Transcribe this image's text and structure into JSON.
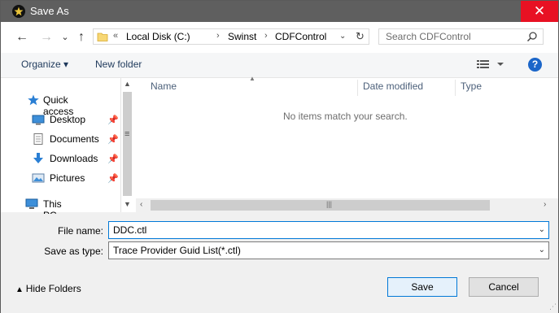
{
  "window": {
    "title": "Save As",
    "close_glyph": "✕"
  },
  "nav": {
    "back_glyph": "←",
    "forward_glyph": "→",
    "recent_glyph": "⌄",
    "up_glyph": "↑",
    "breadcrumb": {
      "overflow": "«",
      "segments": [
        "Local Disk (C:)",
        "Swinst",
        "CDFControl"
      ],
      "separator": "›"
    },
    "search_placeholder": "Search CDFControl"
  },
  "toolbar": {
    "organize": "Organize ▾",
    "new_folder": "New folder",
    "help": "?"
  },
  "navpane": {
    "items": [
      {
        "label": "Quick access",
        "icon": "star-icon"
      },
      {
        "label": "Desktop",
        "icon": "desktop-icon",
        "pinned": true
      },
      {
        "label": "Documents",
        "icon": "documents-icon",
        "pinned": true
      },
      {
        "label": "Downloads",
        "icon": "downloads-icon",
        "pinned": true
      },
      {
        "label": "Pictures",
        "icon": "pictures-icon",
        "pinned": true
      },
      {
        "label": "This PC",
        "icon": "computer-icon"
      }
    ]
  },
  "filelist": {
    "columns": [
      "Name",
      "Date modified",
      "Type"
    ],
    "empty_message": "No items match your search."
  },
  "form": {
    "file_name_label": "File name:",
    "file_name_value": "DDC.ctl",
    "save_type_label": "Save as type:",
    "save_type_value": "Trace Provider Guid List(*.ctl)"
  },
  "footer": {
    "hide_folders": "Hide Folders",
    "save": "Save",
    "cancel": "Cancel"
  },
  "colors": {
    "close_red": "#e81123",
    "accent_blue": "#0078d7",
    "help_blue": "#1b66c9",
    "titlebar_gray": "#5f5f5f"
  }
}
